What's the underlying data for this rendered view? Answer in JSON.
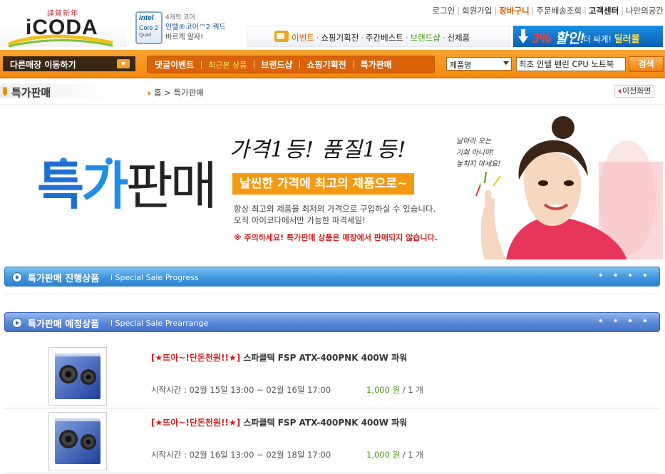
{
  "header": {
    "logo_slogan": "謹賀新年",
    "logo_text": "iCODA",
    "intel": {
      "badge_brand": "intel",
      "badge_line": "Core 2",
      "badge_sub": "Quad",
      "copy_line1": "4개의 코어",
      "copy_line2": "인텔®코어™2 쿼드",
      "copy_line3": "바르게 알자!"
    },
    "top_links": [
      "로그인",
      "회원가입",
      "장바구니",
      "주문배송조회",
      "고객센터",
      "나만의공간"
    ],
    "promo_bar": {
      "items": [
        "이벤트",
        "쇼핑기획전",
        "주간베스트",
        "브랜드샵",
        "신제품"
      ]
    },
    "sale_banner": {
      "percent": "3%",
      "label": "할인!",
      "text": "더 싸게!",
      "highlight": "딜러몰"
    }
  },
  "nav": {
    "store_select_label": "다른매장 이동하기",
    "menu": [
      "댓글이벤트",
      "최근본 상품",
      "브랜드샵",
      "쇼핑기획전",
      "특가판매"
    ],
    "search_field_label": "제품명",
    "search_value": "최초 인텔 펜린 CPU 노트북",
    "search_button": "검색"
  },
  "page": {
    "title": "특가판매",
    "breadcrumb": [
      "홈",
      "특가판매"
    ],
    "breadcrumb_sep": ">",
    "prev_button": "이전화면"
  },
  "hero": {
    "big_chars": [
      "특",
      "가",
      "판매"
    ],
    "script": "가격1등! 품질1등!",
    "tag": "날씬한 가격에 최고의 제품으로~",
    "desc_line1": "항상 최고의 제품을 최저의 가격으로 구입하실 수 있습니다.",
    "desc_line2": "오직 아이코다에서만 가능한 파격세일!",
    "warning": "※ 주의하세요! 특가판매 상품은 매장에서 판매되지 않습니다.",
    "bubble_line1": "날아라 오는",
    "bubble_line2": "기회 아니야!",
    "bubble_line3": "놓치지 마세요!"
  },
  "sections": {
    "progress": {
      "title": "특가판매 진행상품",
      "subtitle": "l Special Sale Progress",
      "dots": "• • • •"
    },
    "prearrange": {
      "title": "특가판매 예정상품",
      "subtitle": "l Special Sale Prearrange",
      "dots": "• • • •"
    }
  },
  "products": [
    {
      "promo": "[★뜨아~!단돈천원!!★]",
      "name": "스파클텍 FSP ATX-400PNK 400W 파워",
      "time_label": "시작시간 :",
      "time": "02월 15일 13:00 ~ 02월 16일 17:00",
      "price": "1,000 원",
      "qty": "/ 1 개"
    },
    {
      "promo": "[★뜨아~!단돈천원!!★]",
      "name": "스파클텍 FSP ATX-400PNK 400W 파워",
      "time_label": "시작시간 :",
      "time": "02월 16일 13:00 ~ 02월 18일 17:00",
      "price": "1,000 원",
      "qty": "/ 1 개"
    }
  ],
  "colors": {
    "nav_orange": "#f28a10",
    "accent_blue": "#1e6fd0",
    "promo_red": "#d61a1a",
    "price_green": "#4a9a12"
  }
}
